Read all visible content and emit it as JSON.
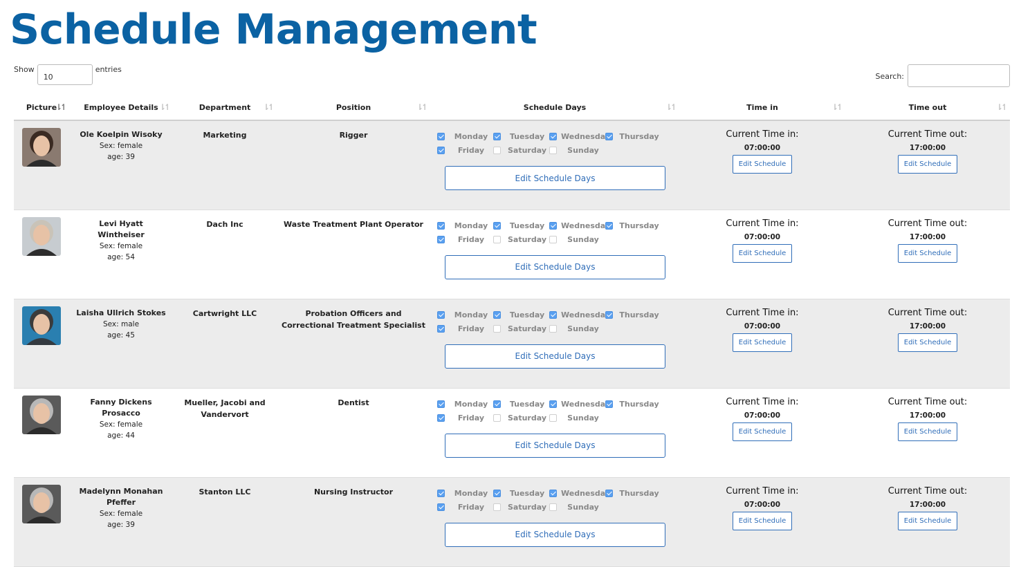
{
  "page_title": "Schedule Management",
  "length": {
    "show_label": "Show",
    "value": "10",
    "entries_label": "entries"
  },
  "search": {
    "label": "Search:",
    "value": ""
  },
  "columns": [
    "Picture",
    "Employee Details",
    "Department",
    "Position",
    "Schedule Days",
    "Time in",
    "Time out"
  ],
  "day_names": [
    "Monday",
    "Tuesday",
    "Wednesday",
    "Thursday",
    "Friday",
    "Saturday",
    "Sunday"
  ],
  "edit_days_label": "Edit Schedule Days",
  "time_in_heading": "Current Time in:",
  "time_out_heading": "Current Time out:",
  "edit_schedule_label": "Edit Schedule",
  "rows": [
    {
      "avatar_icon": "woman-portrait-icon",
      "name": "Ole Koelpin Wisoky",
      "sex": "Sex: female",
      "age": "age: 39",
      "department": "Marketing",
      "position": "Rigger",
      "days": [
        true,
        true,
        true,
        true,
        true,
        false,
        false
      ],
      "time_in": "07:00:00",
      "time_out": "17:00:00"
    },
    {
      "avatar_icon": "man-portrait-icon",
      "name": "Levi Hyatt Wintheiser",
      "sex": "Sex: female",
      "age": "age: 54",
      "department": "Dach Inc",
      "position": "Waste Treatment Plant Operator",
      "days": [
        true,
        true,
        true,
        true,
        true,
        false,
        false
      ],
      "time_in": "07:00:00",
      "time_out": "17:00:00"
    },
    {
      "avatar_icon": "man-portrait-icon",
      "name": "Laisha Ullrich Stokes",
      "sex": "Sex: male",
      "age": "age: 45",
      "department": "Cartwright LLC",
      "position": "Probation Officers and Correctional Treatment Specialist",
      "days": [
        true,
        true,
        true,
        true,
        true,
        false,
        false
      ],
      "time_in": "07:00:00",
      "time_out": "17:00:00"
    },
    {
      "avatar_icon": "man-portrait-icon",
      "name": "Fanny Dickens Prosacco",
      "sex": "Sex: female",
      "age": "age: 44",
      "department": "Mueller, Jacobi and Vandervort",
      "position": "Dentist",
      "days": [
        true,
        true,
        true,
        true,
        true,
        false,
        false
      ],
      "time_in": "07:00:00",
      "time_out": "17:00:00"
    },
    {
      "avatar_icon": "man-portrait-icon",
      "name": "Madelynn Monahan Pfeffer",
      "sex": "Sex: female",
      "age": "age: 39",
      "department": "Stanton LLC",
      "position": "Nursing Instructor",
      "days": [
        true,
        true,
        true,
        true,
        true,
        false,
        false
      ],
      "time_in": "07:00:00",
      "time_out": "17:00:00"
    }
  ]
}
